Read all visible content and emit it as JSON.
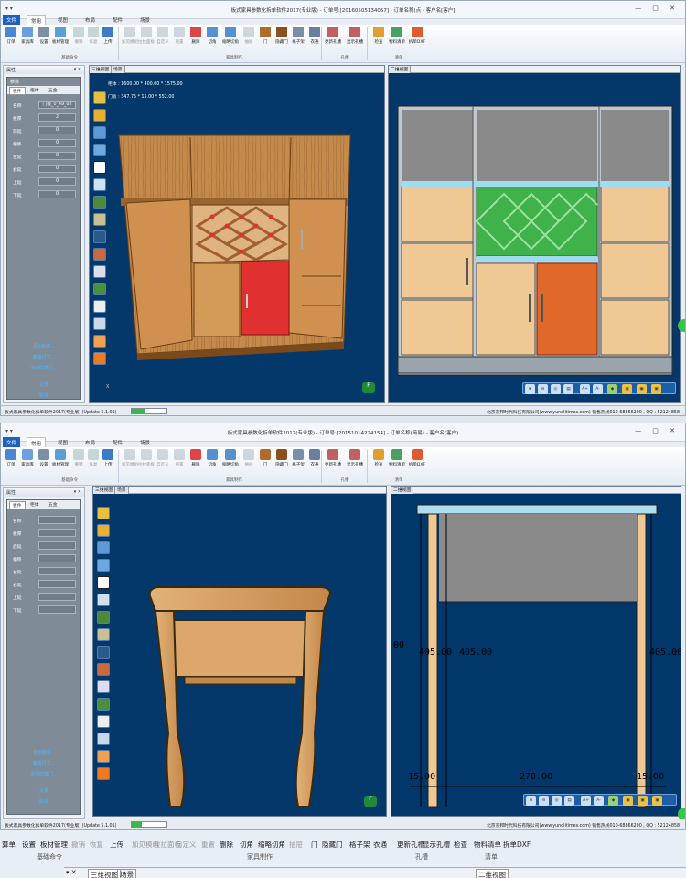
{
  "w1": {
    "title": "板式家具参数化拆单软件2017(专业版) - 订单号:[20160505134057] - 订单名称(点 - 客户名[客户]",
    "qa": "▾ ▾",
    "tabs": [
      "文件",
      "常用",
      "视图",
      "布局",
      "配件",
      "场景"
    ],
    "ribbon": {
      "buttons": [
        "订单",
        "家具库",
        "设置",
        "板材管理",
        "撤销",
        "恢复",
        "上传",
        "加见模组",
        "拉拉面板",
        "自定义",
        "重置",
        "删除",
        "切角",
        "缩略切角",
        "抽屉",
        "门",
        "隐藏门",
        "格子架",
        "衣通",
        "更新孔槽",
        "显示孔槽",
        "检查",
        "物料清单",
        "拆单DXF"
      ],
      "groups": [
        "基础命令",
        "家具制作",
        "孔槽",
        "清单"
      ]
    },
    "panel": {
      "title": "属性",
      "params_title": "参数",
      "tabs": [
        "板件",
        "柜体",
        "五金"
      ],
      "rows": [
        {
          "k": "名称",
          "v": "门板_0_49_02"
        },
        {
          "k": "板厚",
          "v": "2"
        },
        {
          "k": "前延",
          "v": "0"
        },
        {
          "k": "偏移",
          "v": "0"
        },
        {
          "k": "左延",
          "v": "0"
        },
        {
          "k": "右延",
          "v": "0"
        },
        {
          "k": "上延",
          "v": "0"
        },
        {
          "k": "下延",
          "v": "0"
        }
      ],
      "links": [
        "添加板件...",
        "编辑尺寸...",
        "添加隐藏门...",
        "设置",
        "取消"
      ]
    },
    "view3d": {
      "tabs": [
        "三维视图",
        "场景"
      ],
      "info1": "柜体 : 1600.00 * 400.00 * 1575.00",
      "info2": "门板 : 347.75 * 15.00 * 552.00",
      "axis": "X"
    },
    "view2d": {
      "tab": "二维视图"
    },
    "status": {
      "left": "板式家具参数化拆单软件2017(专业版) (Update 5.1.01)",
      "right": "北京京邦时代科技有限公司(www.yunolitimes.com)  销售热线010-68866200 , QQ : 52124858",
      "progress": 0.4
    }
  },
  "w2": {
    "title": "板式家具参数化拆单软件2017(专业版) - 订单号:[20151014224154] - 订单名称(简易) - 客户名(客户)",
    "qa": "▾ ▾",
    "tabs": [
      "文件",
      "常用",
      "视图",
      "布局",
      "配件",
      "场景"
    ],
    "ribbon": {
      "buttons": [
        "订单",
        "家具库",
        "设置",
        "板材管理",
        "撤销",
        "恢复",
        "上传",
        "加见模组",
        "拉拉面板",
        "自定义",
        "重置",
        "删除",
        "切角",
        "缩略切角",
        "抽屉",
        "门",
        "隐藏门",
        "格子架",
        "衣通",
        "更新孔槽",
        "显示孔槽",
        "检查",
        "物料清单",
        "拆单DXF"
      ],
      "groups": [
        "基础命令",
        "家具制作",
        "孔槽",
        "清单"
      ]
    },
    "panel": {
      "title": "属性",
      "tabs": [
        "板件",
        "柜体",
        "五金"
      ],
      "rows": [
        {
          "k": "名称",
          "v": ""
        },
        {
          "k": "板厚",
          "v": ""
        },
        {
          "k": "后延",
          "v": ""
        },
        {
          "k": "偏移",
          "v": ""
        },
        {
          "k": "左延",
          "v": ""
        },
        {
          "k": "右延",
          "v": ""
        },
        {
          "k": "上延",
          "v": ""
        },
        {
          "k": "下延",
          "v": ""
        }
      ],
      "links": [
        "添加板件...",
        "编辑尺寸...",
        "添加隐藏门...",
        "设置",
        "取消"
      ]
    },
    "view3d": {
      "tabs": [
        "三维视图",
        "场景"
      ]
    },
    "view2d": {
      "tab": "二维视图",
      "dims": [
        "405.00",
        "405.00",
        "405.00",
        "00",
        "15.00",
        "270.00",
        "15.00"
      ]
    },
    "status": {
      "left": "板式家具参数化拆单软件2017(专业版) (Update 5.1.01)",
      "right": "北京京邦时代科技有限公司(www.yunolitimes.com)  销售热线010-68866200 , QQ : 52124858",
      "progress": 0.3
    }
  },
  "bottom": {
    "buttons": [
      "算单",
      "设置",
      "板材管理",
      "撤销",
      "恢复",
      "上传",
      "加见模组",
      "拉拉面板",
      "自定义",
      "重置",
      "删除",
      "切角",
      "缩略切角",
      "抽屉",
      "门",
      "隐藏门",
      "格子架",
      "衣通",
      "更新孔槽",
      "显示孔槽",
      "检查",
      "物料清单",
      "拆单DXF"
    ],
    "groups": [
      "基础命令",
      "家具制作",
      "孔槽",
      "清单"
    ],
    "tabs": [
      "三维视图",
      "场景"
    ],
    "tab2d": "二维视图"
  },
  "colors": {
    "viewport": "#04386a",
    "accent": "#1f5fbf",
    "wood": "#c8924f",
    "door_red": "#e03030",
    "door_orange": "#e0682a",
    "rack_green": "#3fb34a"
  }
}
